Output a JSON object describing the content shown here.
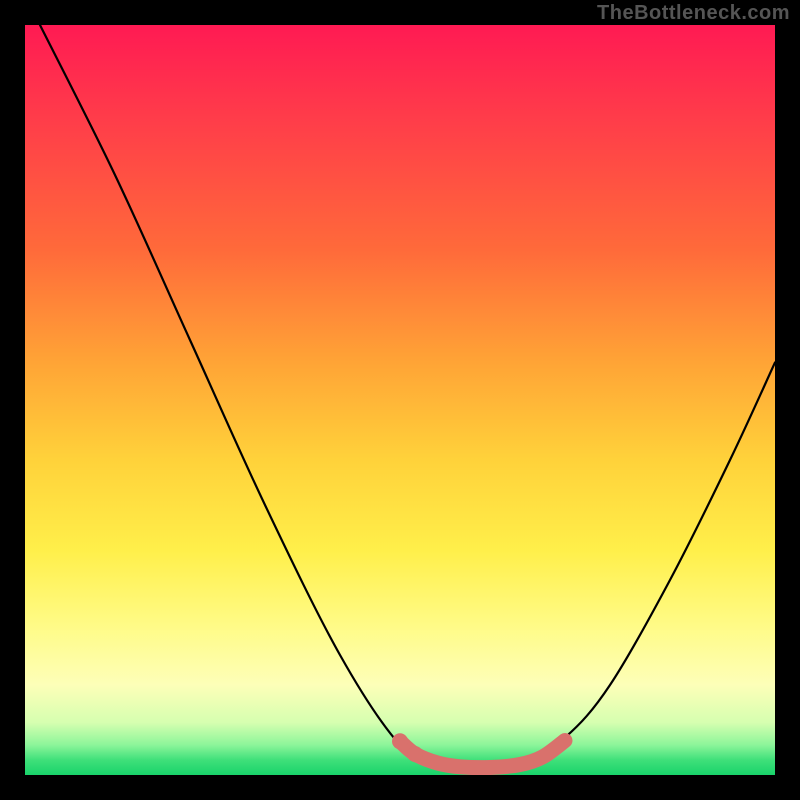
{
  "watermark_text": "TheBottleneck.com",
  "chart_data": {
    "type": "line",
    "title": "",
    "xlabel": "",
    "ylabel": "",
    "x_range": [
      0,
      100
    ],
    "y_range": [
      0,
      100
    ],
    "curve_points_xy": [
      [
        2,
        100
      ],
      [
        12,
        80
      ],
      [
        22,
        58
      ],
      [
        32,
        36
      ],
      [
        42,
        16
      ],
      [
        50,
        4
      ],
      [
        55,
        1.5
      ],
      [
        60,
        1
      ],
      [
        66,
        1.5
      ],
      [
        72,
        5
      ],
      [
        78,
        12
      ],
      [
        86,
        26
      ],
      [
        94,
        42
      ],
      [
        100,
        55
      ]
    ],
    "highlight_segment_xy": [
      [
        50,
        4.5
      ],
      [
        52,
        2.8
      ],
      [
        55,
        1.6
      ],
      [
        58,
        1.1
      ],
      [
        62,
        1.0
      ],
      [
        66,
        1.4
      ],
      [
        69,
        2.4
      ],
      [
        72,
        4.6
      ]
    ],
    "highlight_color": "#d9716c",
    "curve_color": "#000000",
    "background_gradient": {
      "top": "#ff1a53",
      "mid": "#ffe84a",
      "bottom": "#19d36b"
    }
  }
}
